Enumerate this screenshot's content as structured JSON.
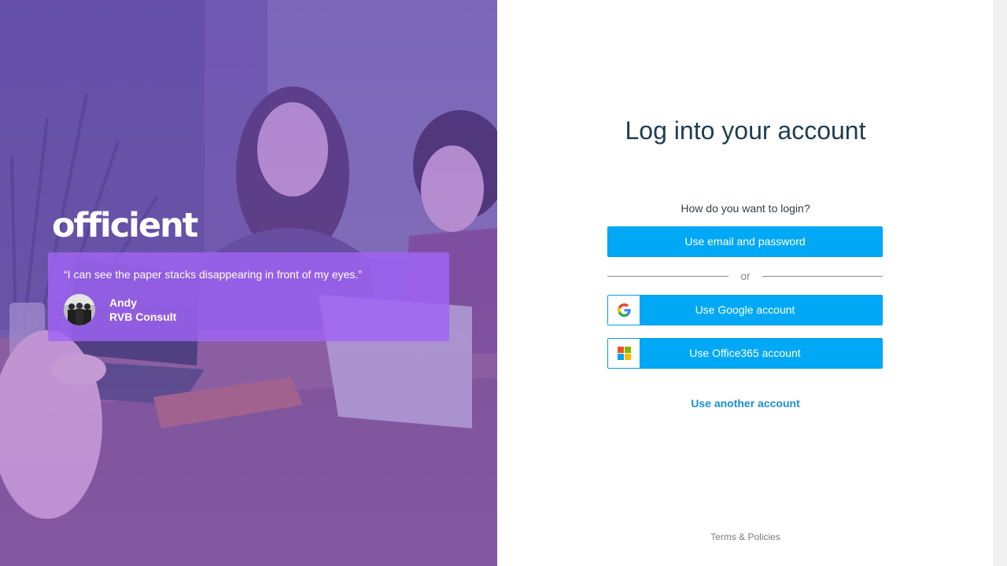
{
  "hero": {
    "logo_text": "officient",
    "testimonial": {
      "quote": "“I can see the paper stacks disappearing in front of my eyes.”",
      "author_name": "Andy",
      "author_company": "RVB Consult"
    },
    "overlay_color": "#9a64f5"
  },
  "login": {
    "title": "Log into your account",
    "question": "How do you want to login?",
    "email_button_label": "Use email and password",
    "divider_text": "or",
    "google_button_label": "Use Google account",
    "office_button_label": "Use Office365 account",
    "another_account_link": "Use another account",
    "terms_link": "Terms & Policies",
    "button_color": "#00a8f5",
    "link_color": "#1b8fd6",
    "title_color": "#1f3e4f"
  },
  "icons": {
    "google": "google-g-icon",
    "office": "microsoft-logo-icon"
  }
}
